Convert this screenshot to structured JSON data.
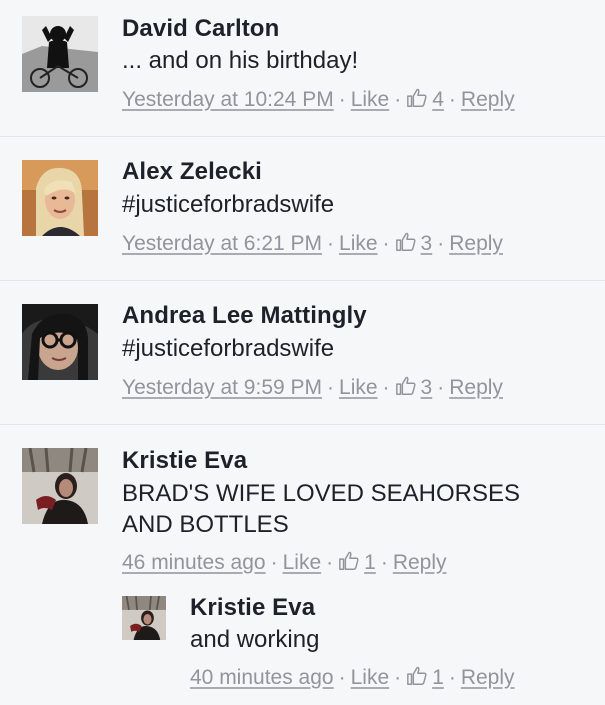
{
  "comments": [
    {
      "name": "David Carlton",
      "text": "... and on his birthday!",
      "time": "Yesterday at 10:24 PM",
      "like": "Like",
      "count": "4",
      "reply": "Reply"
    },
    {
      "name": "Alex Zelecki",
      "text": "#justiceforbradswife",
      "time": "Yesterday at 6:21 PM",
      "like": "Like",
      "count": "3",
      "reply": "Reply"
    },
    {
      "name": "Andrea Lee Mattingly",
      "text": "#justiceforbradswife",
      "time": "Yesterday at 9:59 PM",
      "like": "Like",
      "count": "3",
      "reply": "Reply"
    },
    {
      "name": "Kristie Eva",
      "text_line1": "BRAD'S WIFE LOVED SEAHORSES",
      "text_line2": "AND BOTTLES",
      "time": "46 minutes ago",
      "like": "Like",
      "count": "1",
      "reply": "Reply"
    }
  ],
  "reply": {
    "name": "Kristie Eva",
    "text": "and working",
    "time": "40 minutes ago",
    "like": "Like",
    "count": "1",
    "reply": "Reply"
  },
  "icons": {
    "thumb": "thumbs-up-icon",
    "separator": "·"
  },
  "colors": {
    "meta": "#90949c",
    "text": "#1d2129",
    "background": "#f6f7f9"
  }
}
